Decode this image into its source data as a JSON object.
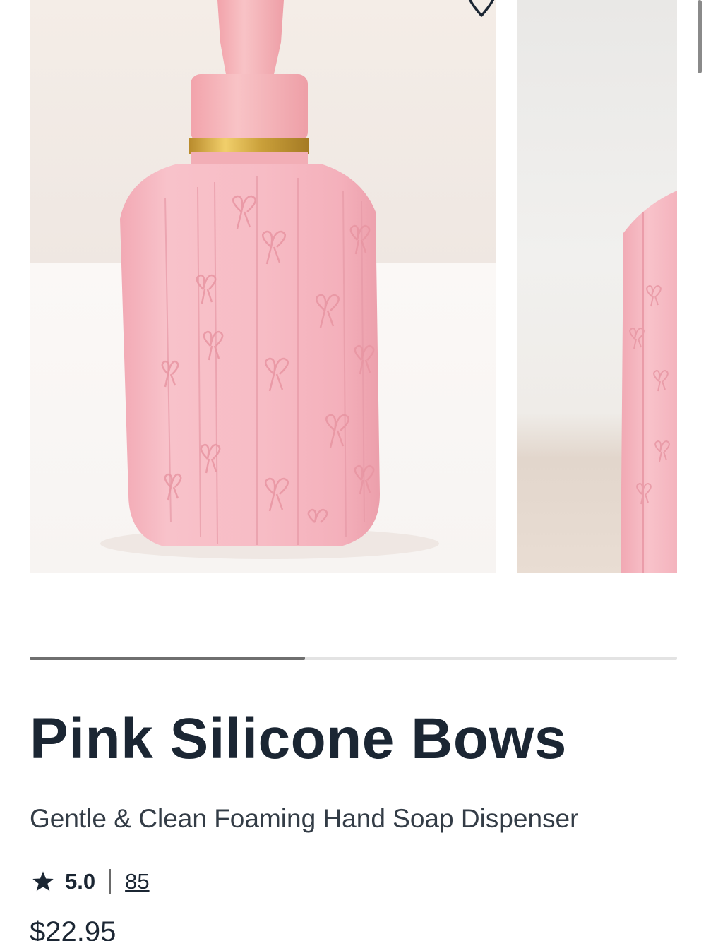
{
  "product": {
    "title": "Pink Silicone Bows",
    "subtitle": "Gentle & Clean Foaming Hand Soap Dispenser",
    "rating": "5.0",
    "review_count": "85",
    "price": "$22.95"
  },
  "gallery": {
    "image_count_visible": 2,
    "progress_fraction": 0.425,
    "wishlist_icon": "heart-outline-icon",
    "rating_icon": "star-icon"
  },
  "colors": {
    "text": "#1b2633",
    "product_pink": "#f6b9c2",
    "pump_pink": "#f4b1b6",
    "gold_band": "#d9a33a",
    "progress_fill": "#6f6f6f",
    "progress_track": "#e3e3e3"
  }
}
